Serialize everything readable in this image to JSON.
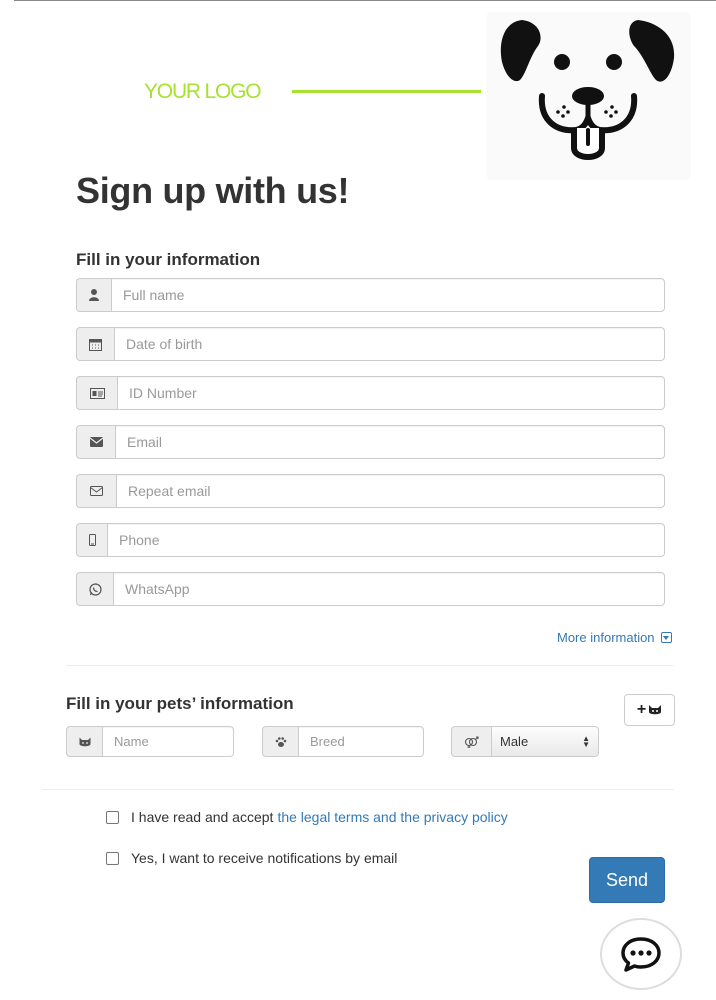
{
  "brand": {
    "logo_text": "YOUR LOGO",
    "logo_color": "#a6e22e",
    "mascot_icon": "dog-face-icon"
  },
  "page": {
    "title": "Sign up with us!"
  },
  "personal_section": {
    "heading": "Fill in your information",
    "fields": [
      {
        "icon": "user-icon",
        "placeholder": "Full name",
        "value": ""
      },
      {
        "icon": "calendar-icon",
        "placeholder": "Date of birth",
        "value": ""
      },
      {
        "icon": "id-card-icon",
        "placeholder": "ID Number",
        "value": ""
      },
      {
        "icon": "envelope-filled-icon",
        "placeholder": "Email",
        "value": ""
      },
      {
        "icon": "envelope-outline-icon",
        "placeholder": "Repeat email",
        "value": ""
      },
      {
        "icon": "mobile-phone-icon",
        "placeholder": "Phone",
        "value": ""
      },
      {
        "icon": "whatsapp-icon",
        "placeholder": "WhatsApp",
        "value": ""
      }
    ],
    "more_info_label": "More information"
  },
  "pets_section": {
    "heading": "Fill in your pets’ information",
    "add_pet_icon": "add-pet-icon",
    "name_placeholder": "Name",
    "breed_placeholder": "Breed",
    "gender_selected": "Male"
  },
  "consent": {
    "terms_prefix": "I have read and accept",
    "terms_link": "the legal terms and the privacy policy",
    "notifications_label": "Yes, I want to receive notifications by email",
    "terms_checked": false,
    "notifications_checked": false
  },
  "actions": {
    "send_label": "Send",
    "primary_color": "#337ab7",
    "chat_icon": "chat-bubble-icon"
  }
}
